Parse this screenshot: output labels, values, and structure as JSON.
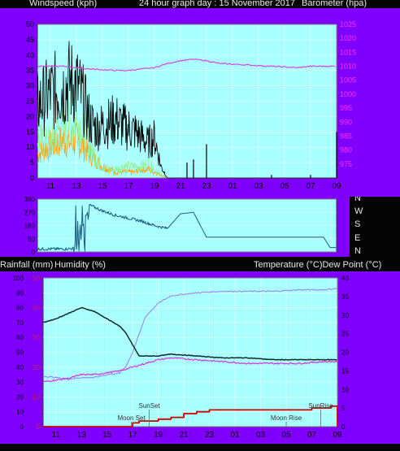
{
  "header": {
    "left": "Windspeed (kph)",
    "center": "24 hour graph day : 15 November 2017",
    "right": "Barometer (hpa)"
  },
  "middle_header": {
    "left_a": "Rainfall (mm)",
    "left_b": "Humidity (%)",
    "right": "Temperature (°C)Dew Point (°C)"
  },
  "compass": [
    "N",
    "W",
    "S",
    "E",
    "N"
  ],
  "colors": {
    "frame": "#8000ff",
    "plot_bg": "#aaffff",
    "wind": "#000000",
    "gust_green": "#90ee90",
    "gust_orange": "#ff9900",
    "baro": "#dd44dd",
    "dir": "#1a5a80",
    "temp": "#0f2a2a",
    "dew": "#dd22dd",
    "humidity": "#9a88ee",
    "rain": "#cc0000",
    "baro_axis": "#ff33ff",
    "rain_axis": "#cc2222"
  },
  "chart_data": [
    {
      "type": "line",
      "title": "24 hour graph day : 15 November 2017",
      "ylabel": "Windspeed (kph)",
      "y2label": "Barometer (hpa)",
      "x_ticks": [
        "11",
        "13",
        "15",
        "17",
        "19",
        "21",
        "23",
        "01",
        "03",
        "05",
        "07",
        "09"
      ],
      "ylim": [
        0,
        50
      ],
      "y_ticks": [
        0,
        5,
        10,
        15,
        20,
        25,
        30,
        35,
        40,
        45,
        50
      ],
      "y2lim": [
        970,
        1025
      ],
      "y2_ticks": [
        975,
        980,
        985,
        990,
        995,
        1000,
        1005,
        1010,
        1015,
        1020,
        1025
      ],
      "series": [
        {
          "x": [
            10,
            10.5,
            11,
            11.5,
            12,
            12.5,
            13,
            13.5,
            14,
            14.5,
            15,
            15.5,
            16,
            16.5,
            17,
            17.5,
            18,
            18.5,
            19,
            19.5,
            20,
            22,
            24,
            26,
            28,
            30,
            32,
            33
          ],
          "values": [
            25,
            27,
            29,
            30,
            31,
            33,
            32,
            27,
            20,
            17,
            18,
            19,
            20,
            18,
            17,
            16,
            14,
            12,
            14,
            4,
            0,
            0,
            0,
            0,
            0,
            0,
            0,
            0
          ]
        },
        {
          "x": [
            10,
            10.5,
            11,
            11.5,
            12,
            12.5,
            13,
            13.5,
            14,
            14.5,
            15,
            15.5,
            16,
            16.5,
            17,
            17.5,
            18,
            18.5,
            19,
            19.5,
            20,
            22,
            24,
            26,
            28,
            30,
            32,
            33
          ],
          "values": [
            14,
            12,
            13,
            16,
            17,
            18,
            20,
            16,
            12,
            7,
            4,
            3,
            3,
            4,
            4,
            4,
            4,
            5,
            3,
            1,
            0,
            0,
            0,
            0,
            0,
            0,
            0,
            0
          ]
        },
        {
          "x": [
            10,
            10.5,
            11,
            11.5,
            12,
            12.5,
            13,
            13.5,
            14,
            14.5,
            15,
            15.5,
            16,
            16.5,
            17,
            17.5,
            18,
            18.5,
            19,
            19.5,
            20,
            22,
            24,
            26,
            28,
            30,
            32,
            33
          ],
          "values": [
            8,
            10,
            11,
            12,
            13,
            12,
            13,
            11,
            8,
            6,
            4,
            3,
            2,
            2,
            2,
            2,
            3,
            3,
            2,
            1,
            0,
            0,
            0,
            0,
            0,
            0,
            0,
            0
          ]
        },
        {
          "x": [
            10,
            12,
            14,
            16,
            17,
            18,
            19,
            20,
            21,
            22,
            23,
            24,
            26,
            28,
            30,
            31,
            32,
            33
          ],
          "values": [
            1010,
            1010,
            1009,
            1008.5,
            1008.5,
            1009,
            1009.5,
            1011,
            1012,
            1012.5,
            1012,
            1011,
            1010.5,
            1010,
            1009.5,
            1010,
            1010,
            1010
          ]
        }
      ]
    },
    {
      "type": "line",
      "ylabel": "Wind direction",
      "ylim": [
        0,
        360
      ],
      "y_ticks": [
        0,
        90,
        180,
        270,
        360
      ],
      "series": [
        {
          "x": [
            10,
            12,
            13,
            14,
            14.5,
            15,
            16,
            17,
            18,
            19,
            19.5,
            20,
            21,
            22,
            23,
            24,
            26,
            28,
            30,
            31,
            32,
            32.5,
            33
          ],
          "values": [
            20,
            20,
            25,
            320,
            300,
            280,
            250,
            230,
            210,
            180,
            170,
            160,
            260,
            270,
            100,
            100,
            100,
            100,
            100,
            100,
            100,
            30,
            30
          ]
        }
      ]
    },
    {
      "type": "line",
      "ylabel": "Humidity (%)",
      "y2label": "Temperature (°C)Dew Point (°C)",
      "x_ticks": [
        "11",
        "13",
        "15",
        "17",
        "19",
        "21",
        "23",
        "01",
        "03",
        "05",
        "07",
        "09"
      ],
      "ylim": [
        0,
        100
      ],
      "y_ticks": [
        0,
        10,
        20,
        30,
        40,
        50,
        60,
        70,
        80,
        90,
        100
      ],
      "rain_ylim": [
        0,
        50
      ],
      "rain_ticks": [
        0,
        10,
        20,
        30,
        40,
        50
      ],
      "y2lim": [
        0,
        40
      ],
      "y2_ticks": [
        0,
        5,
        10,
        15,
        20,
        25,
        30,
        35,
        40
      ],
      "annotations": [
        "Moon Set",
        "SunSet",
        "SunRise",
        "Moon Rise"
      ],
      "series": [
        {
          "x": [
            10,
            11,
            12,
            13,
            14,
            15,
            16,
            16.5,
            17,
            17.5,
            18,
            19,
            20,
            22,
            24,
            26,
            28,
            30,
            32,
            33
          ],
          "values": [
            28,
            29,
            30.5,
            32,
            31,
            29,
            27,
            25,
            22,
            19,
            19,
            19,
            19.5,
            19,
            18.5,
            18.5,
            18,
            18,
            18,
            18
          ]
        },
        {
          "x": [
            10,
            11,
            12,
            13,
            14,
            15,
            16,
            17,
            18,
            19,
            20,
            22,
            24,
            26,
            28,
            30,
            32,
            33
          ],
          "values": [
            12,
            12.5,
            13,
            14,
            14,
            14.5,
            15,
            16,
            17,
            18,
            18.5,
            18,
            17.5,
            17,
            17,
            17,
            17.5,
            17.5
          ]
        },
        {
          "x": [
            10,
            11,
            12,
            13,
            14,
            15,
            16,
            16.5,
            17,
            17.5,
            18,
            19,
            20,
            21,
            22,
            24,
            26,
            28,
            30,
            32,
            33
          ],
          "values": [
            34,
            33,
            32,
            33,
            33,
            35,
            36,
            41,
            50,
            62,
            74,
            83,
            88,
            89,
            90,
            91,
            91,
            91,
            92,
            92,
            93
          ]
        },
        {
          "x": [
            10,
            16.9,
            17,
            17.5,
            18,
            19,
            20,
            21,
            22,
            23,
            24,
            26,
            28,
            30,
            31,
            32,
            32.5,
            33
          ],
          "values": [
            0,
            0,
            1,
            1.5,
            1.5,
            2,
            2.5,
            3.5,
            4,
            4.5,
            4.5,
            4.5,
            4.5,
            4.5,
            5,
            5,
            5.5,
            0
          ]
        }
      ]
    }
  ]
}
